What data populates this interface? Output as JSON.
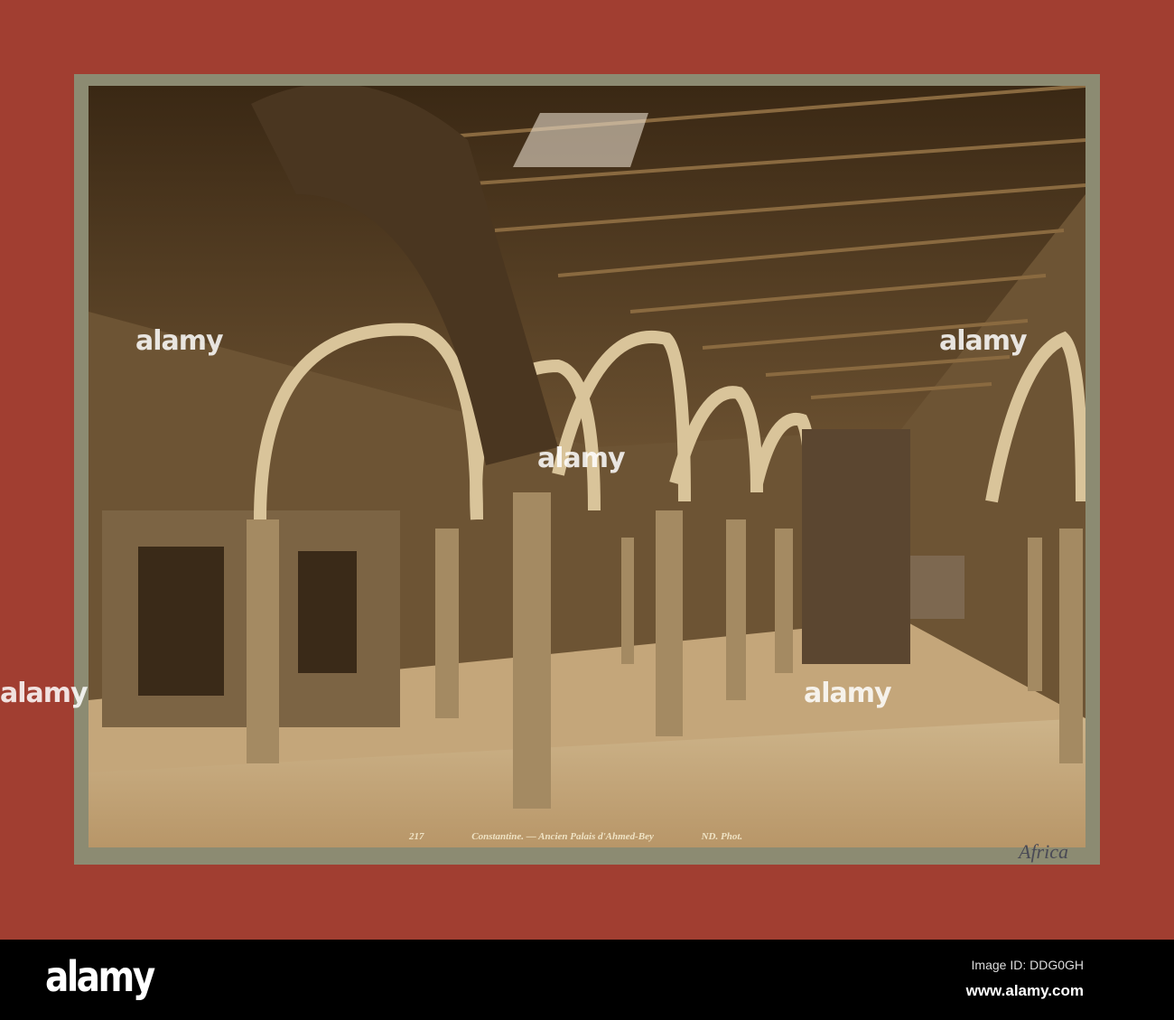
{
  "photo": {
    "caption_number": "217",
    "caption_title": "Constantine. — Ancien Palais d'Ahmed-Bey",
    "caption_credit": "ND. Phot.",
    "handwritten_note": "Africa"
  },
  "watermark": "alamy",
  "footer": {
    "logo": "alamy",
    "image_id": "Image ID: DDG0GH",
    "website": "www.alamy.com"
  }
}
